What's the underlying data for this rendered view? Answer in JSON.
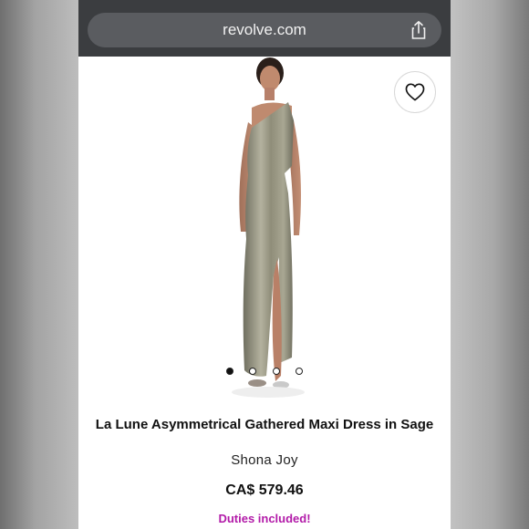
{
  "browser": {
    "url": "revolve.com",
    "share_icon": "share-icon"
  },
  "product": {
    "wishlist_icon": "heart-icon",
    "image_alt": "Model wearing sage satin one-shoulder maxi dress",
    "carousel": {
      "count": 4,
      "active_index": 0
    },
    "title": "La Lune Asymmetrical Gathered Maxi Dress in Sage",
    "brand": "Shona Joy",
    "price": "CA$ 579.46",
    "duties_note": "Duties included!",
    "duties_color": "#b21aa8"
  }
}
